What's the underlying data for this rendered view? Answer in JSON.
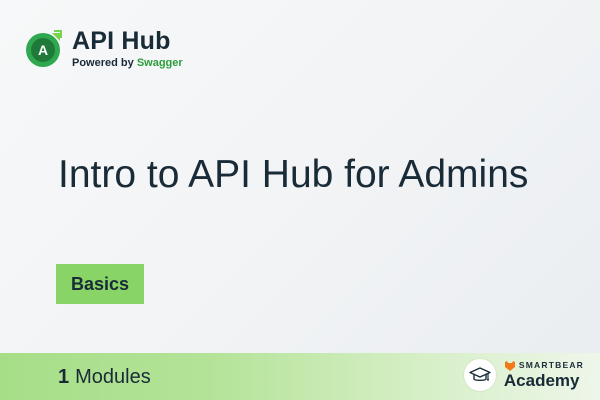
{
  "brand": {
    "logo_letter": "A",
    "name": "API Hub",
    "powered_by": "Powered by",
    "powered_by_brand": "Swagger",
    "icon": "api-hub-logo"
  },
  "course": {
    "title": "Intro to API Hub for Admins",
    "level": "Basics",
    "modules_count": "1",
    "modules_label": "Modules"
  },
  "footer": {
    "partner_small": "SMARTBEAR",
    "partner_large": "Academy",
    "icon": "graduation-cap-icon"
  },
  "colors": {
    "accent_green": "#88d466",
    "brand_green": "#2a9d3a",
    "text_dark": "#1a2b38"
  }
}
